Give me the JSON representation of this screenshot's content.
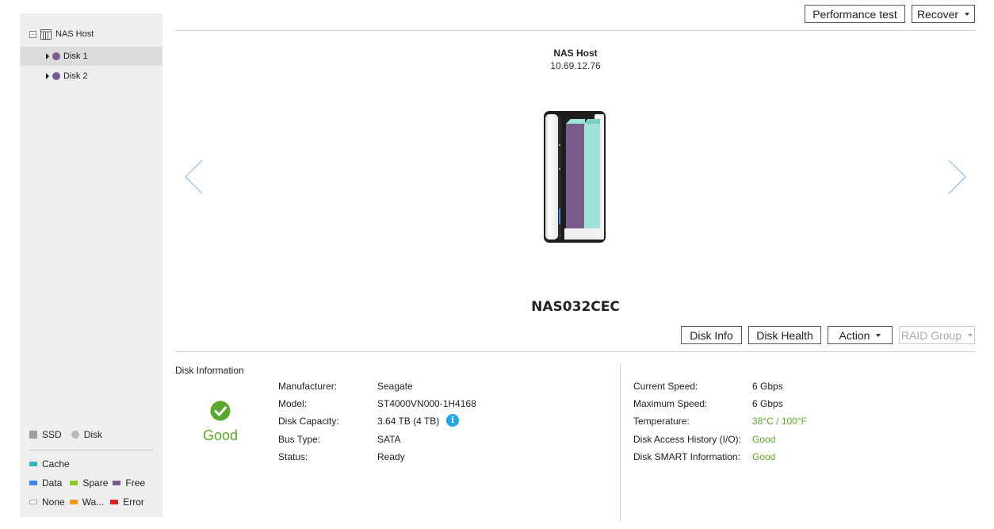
{
  "sidebar": {
    "host_label": "NAS Host",
    "disks": [
      {
        "label": "Disk 1",
        "selected": true
      },
      {
        "label": "Disk 2",
        "selected": false
      }
    ],
    "legend": {
      "ssd": "SSD",
      "disk": "Disk",
      "cache": "Cache",
      "data": "Data",
      "spare": "Spare",
      "free": "Free",
      "none": "None",
      "warning": "Wa...",
      "error": "Error"
    },
    "colors": {
      "cache": "#33b5c4",
      "data": "#3d8ae6",
      "spare": "#8ac926",
      "free": "#7a5b8d",
      "warning": "#f7941d",
      "error": "#d9251d",
      "disk_dot": "#7a5b8d"
    }
  },
  "toolbar": {
    "performance_test": "Performance test",
    "recover": "Recover"
  },
  "device": {
    "host_name": "NAS Host",
    "ip": "10.69.12.76",
    "model_name": "NAS032CEC"
  },
  "disk_toolbar": {
    "disk_info": "Disk Info",
    "disk_health": "Disk Health",
    "action": "Action",
    "raid_group": "RAID Group"
  },
  "disk_information": {
    "title": "Disk Information",
    "health_status": "Good",
    "left_fields": [
      {
        "label": "Manufacturer:",
        "value": "Seagate"
      },
      {
        "label": "Model:",
        "value": "ST4000VN000-1H4168"
      },
      {
        "label": "Disk Capacity:",
        "value": "3.64 TB (4 TB)"
      },
      {
        "label": "Bus Type:",
        "value": "SATA"
      },
      {
        "label": "Status:",
        "value": "Ready"
      }
    ],
    "right_fields": [
      {
        "label": "Current Speed:",
        "value": "6 Gbps"
      },
      {
        "label": "Maximum Speed:",
        "value": "6 Gbps"
      },
      {
        "label": "Temperature:",
        "value": "38°C / 100°F"
      },
      {
        "label": "Disk Access History (I/O):",
        "value": "Good"
      },
      {
        "label": "Disk SMART Information:",
        "value": "Good"
      }
    ]
  }
}
